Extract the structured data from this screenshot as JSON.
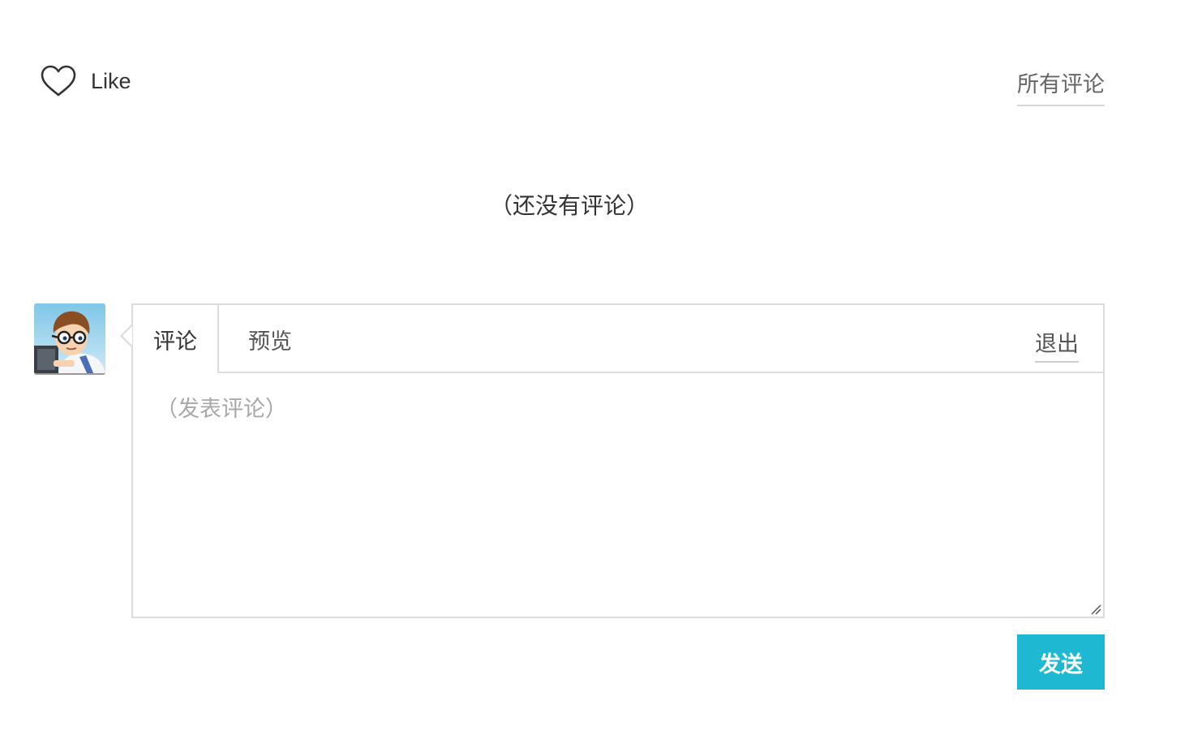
{
  "like": {
    "icon": "heart-outline-icon",
    "label": "Like"
  },
  "header": {
    "all_comments_label": "所有评论"
  },
  "comments": {
    "empty_text": "（还没有评论）"
  },
  "user": {
    "avatar": "cartoon-avatar"
  },
  "editor": {
    "tabs": [
      {
        "label": "评论",
        "active": true
      },
      {
        "label": "预览",
        "active": false
      }
    ],
    "logout_label": "退出",
    "placeholder": "（发表评论）",
    "value": ""
  },
  "actions": {
    "send_label": "发送"
  },
  "colors": {
    "accent": "#1fb8d3",
    "border": "#dcdcdc",
    "text": "#333333",
    "placeholder": "#a8a8a8"
  }
}
